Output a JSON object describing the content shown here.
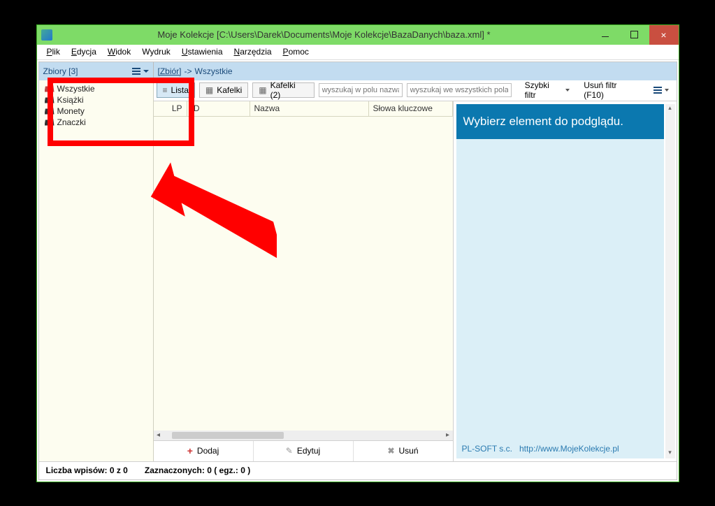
{
  "window": {
    "title": "Moje Kolekcje [C:\\Users\\Darek\\Documents\\Moje Kolekcje\\BazaDanych\\baza.xml] *"
  },
  "menu": {
    "file": "Plik",
    "edit": "Edycja",
    "view": "Widok",
    "print": "Wydruk",
    "settings": "Ustawienia",
    "tools": "Narzędzia",
    "help": "Pomoc"
  },
  "sidebar_header": "Zbiory [3]",
  "breadcrumb": {
    "link": "[Zbiór]",
    "sep": "->",
    "current": "Wszystkie"
  },
  "sidebar": {
    "items": [
      {
        "label": "Wszystkie"
      },
      {
        "label": "Książki"
      },
      {
        "label": "Monety"
      },
      {
        "label": "Znaczki"
      }
    ]
  },
  "toolbar": {
    "view_list": "Lista",
    "view_tiles": "Kafelki",
    "view_tiles2": "Kafelki (2)",
    "search_name_ph": "wyszukaj w polu nazwa",
    "search_all_ph": "wyszukaj we wszystkich polach",
    "quick_filter": "Szybki filtr",
    "clear_filter": "Usuń filtr (F10)"
  },
  "grid": {
    "columns": {
      "lp": "LP",
      "id": "ID",
      "nazwa": "Nazwa",
      "slowa": "Słowa kluczowe"
    }
  },
  "actions": {
    "add": "Dodaj",
    "edit": "Edytuj",
    "delete": "Usuń"
  },
  "preview": {
    "placeholder": "Wybierz element do podglądu.",
    "company": "PL-SOFT s.c.",
    "url": "http://www.MojeKolekcje.pl"
  },
  "status": {
    "count": "Liczba wpisów: 0 z 0",
    "selected": "Zaznaczonych: 0 (  egz.: 0 )"
  }
}
